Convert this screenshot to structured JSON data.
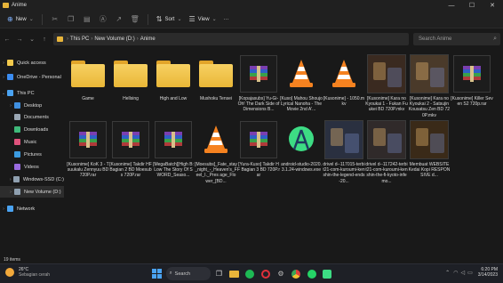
{
  "window": {
    "title": "Anime",
    "minimize": "—",
    "maximize": "☐",
    "close": "✕"
  },
  "toolbar": {
    "new_label": "New",
    "sort_label": "Sort",
    "view_label": "View",
    "more": "···"
  },
  "address": {
    "crumbs": [
      "This PC",
      "New Volume (D:)",
      "Anime"
    ],
    "search_placeholder": "Search Anime"
  },
  "nav": {
    "items": [
      {
        "label": "Quick access",
        "color": "#f2c94c"
      },
      {
        "label": "OneDrive - Personal",
        "color": "#3b8cf0"
      },
      {
        "label": "This PC",
        "color": "#4aa3f2"
      },
      {
        "label": "Desktop",
        "color": "#3f8fe0"
      },
      {
        "label": "Documents",
        "color": "#9aa7b4"
      },
      {
        "label": "Downloads",
        "color": "#3fb97a"
      },
      {
        "label": "Music",
        "color": "#e0537d"
      },
      {
        "label": "Pictures",
        "color": "#3b9be0"
      },
      {
        "label": "Videos",
        "color": "#9a6be0"
      },
      {
        "label": "Windows-SSD (C:)",
        "color": "#8fa0b0"
      },
      {
        "label": "New Volume (D:)",
        "color": "#8fa0b0"
      },
      {
        "label": "Network",
        "color": "#4aa3f2"
      }
    ]
  },
  "files": [
    {
      "name": "Game",
      "kind": "folder"
    },
    {
      "name": "Hellsing",
      "kind": "folder"
    },
    {
      "name": "High and Low",
      "kind": "folder"
    },
    {
      "name": "Mushoku Tensei",
      "kind": "folder"
    },
    {
      "name": "[Kopajasubs] Yu-Gi-Oh! The Dark Side of Dimensions B...",
      "kind": "rar"
    },
    {
      "name": "[Kuso] Mahou Shoujo Lyrical Nanoha - The Movie 2nd A'...",
      "kind": "vlc"
    },
    {
      "name": "[Kusonime] - 1050.mkv",
      "kind": "vlc"
    },
    {
      "name": "[Kusonime] Kara no Kyoukai 1 - Fukan Fuukei BD 720P.mkv",
      "kind": "img",
      "color": "#3a2a20"
    },
    {
      "name": "[Kusonime] Kara no Kyoukai 2 - Satsujin Kousatsu Zen BD 720P.mkv",
      "kind": "img",
      "color": "#4a3a2a"
    },
    {
      "name": "[Kusonime] Killer Seven S2 720p.rar",
      "kind": "rar"
    },
    {
      "name": "[Kusonime] KoK 3 - Tsuukalu Zennyuu BD 720P.rar",
      "kind": "rar"
    },
    {
      "name": "[Kusonime] Takdir HF Bagian 2 BD Moesubs 720P.rar",
      "kind": "rar"
    },
    {
      "name": "[MegaBatch][High B: Low The Story Of SWORD_Seaso...",
      "kind": "rar"
    },
    {
      "name": "[Moesubs]_Fate_stay_night_-_Heaven's_Feel_I._Pres age_Flower_[BD...",
      "kind": "vlc"
    },
    {
      "name": "[Yura-Kuso] Takdir HF Bagian 3 BD 720P.rar",
      "kind": "rar"
    },
    {
      "name": "android-studio-2020.3.1.24-windows.exe",
      "kind": "android"
    },
    {
      "name": "drivel d--117015-terbit21-com-kuroumi-kenshin-the-legend-ends-20...",
      "kind": "img",
      "color": "#2a3040"
    },
    {
      "name": "drivel d--117242-terbit21-com-kuroumi-kenshin-the-fi-kyoto-infemo...",
      "kind": "img",
      "color": "#302a2a"
    },
    {
      "name": "Membuat WEBSITE Kedai Kopi RESPONSIVE d...",
      "kind": "img",
      "color": "#3a2a18"
    }
  ],
  "status": {
    "count": "19 items"
  },
  "taskbar": {
    "weather_temp": "26°C",
    "weather_desc": "Sebagian cerah",
    "search_label": "Search",
    "time": "6:20 PM",
    "date": "3/14/2023"
  }
}
